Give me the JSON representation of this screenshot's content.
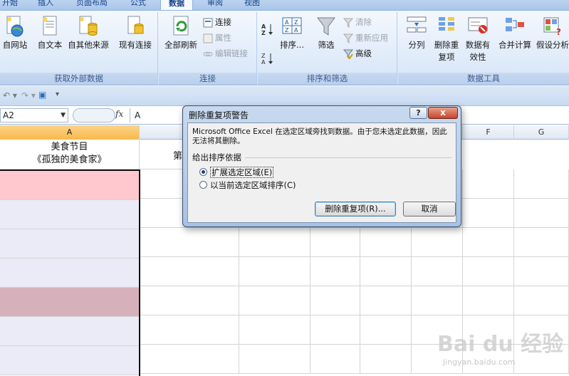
{
  "ribbon": {
    "tabs": [
      "开始",
      "插入",
      "页面布局",
      "公式",
      "数据",
      "审阅",
      "视图"
    ],
    "active_tab": "数据",
    "groups": {
      "external": {
        "label": "获取外部数据",
        "buttons": [
          "自网站",
          "自文本",
          "自其他来源",
          "现有连接"
        ]
      },
      "connections": {
        "label": "连接",
        "refresh_all": "全部刷新",
        "small": [
          "连接",
          "属性",
          "编辑链接"
        ]
      },
      "sort_filter": {
        "label": "排序和筛选",
        "sort": "排序...",
        "filter": "筛选",
        "small": [
          "清除",
          "重新应用",
          "高级"
        ]
      },
      "data_tools": {
        "label": "数据工具",
        "buttons": [
          "分列",
          "删除重复项",
          "数据有效性",
          "合并计算",
          "假设分析"
        ]
      }
    }
  },
  "formula_bar": {
    "name_box": "A2",
    "fx_label": "fx",
    "value": "A"
  },
  "grid": {
    "columns": [
      "A",
      "F",
      "G"
    ],
    "selected_column": "A",
    "header_cell_line1": "美食节目",
    "header_cell_line2": "《孤独的美食家》",
    "partial_b_header": "第",
    "row_colors": [
      "#ffc8cf",
      "#ebeaf7",
      "#ebeaf7",
      "#ebeaf7",
      "#d6b1bb",
      "#ebeaf7",
      "#ebeaf7"
    ]
  },
  "dialog": {
    "title": "删除重复项警告",
    "help_label": "?",
    "close_label": "x",
    "message": "Microsoft Office Excel 在选定区域旁找到数据。由于您未选定此数据，因此无法将其删除。",
    "section_label": "给出排序依据",
    "options": [
      "扩展选定区域(E)",
      "以当前选定区域排序(C)"
    ],
    "selected_option": 0,
    "remove_button": "删除重复项(R)...",
    "cancel_button": "取消"
  },
  "watermark": {
    "logo": "Bai du 经验",
    "url": "jingyan.baidu.com"
  }
}
